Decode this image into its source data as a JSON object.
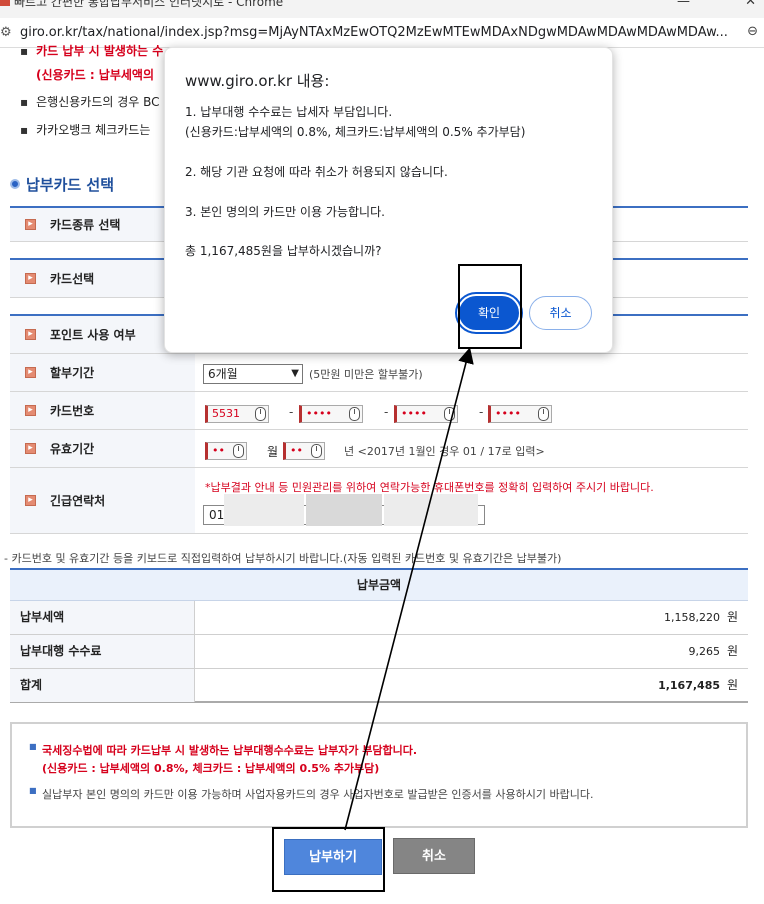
{
  "window": {
    "title": "빠르고 간편한 통합납부서비스 인터넷지로 - Chrome"
  },
  "address_bar": {
    "url": "giro.or.kr/tax/national/index.jsp?msg=MjAyNTAxMzEwOTQ2MzEwMTEwMDAxNDgwMDAwMDAwMDAwMDAw..."
  },
  "notices_top": [
    "카드 납부 시 발생하는 수",
    "(신용카드 : 납부세액의",
    "은행신용카드의 경우 BC",
    "카카오뱅크 체크카드는"
  ],
  "section": {
    "title": "납부카드 선택"
  },
  "form": {
    "card_type_label": "카드종류 선택",
    "card_select_label": "카드선택",
    "point_label": "포인트 사용 여부",
    "installment_label": "할부기간",
    "installment_value": "6개월",
    "installment_note": "(5만원 미만은 할부불가)",
    "card_number_label": "카드번호",
    "card_number_parts": [
      "5531",
      "••••",
      "••••",
      "••••"
    ],
    "expiry_label": "유효기간",
    "expiry_month": "••",
    "expiry_year": "••",
    "month_unit": "월",
    "expiry_note": "년 <2017년 1월인 경우 01 / 17로 입력>",
    "contact_label": "긴급연락처",
    "contact_notice": "*납부결과 안내 등 민원관리를 위하여 연락가능한 휴대폰번호를 정확히 입력하여 주시기 바랍니다.",
    "contact_value": "01"
  },
  "keyboard_note": "- 카드번호 및 유효기간 등을 키보드로 직접입력하여 납부하시기 바랍니다.(자동 입력된 카드번호 및 유효기간은 납부불가)",
  "amount": {
    "header": "납부금액",
    "unit": "원",
    "rows": [
      {
        "label": "납부세액",
        "value": "1,158,220"
      },
      {
        "label": "납부대행 수수료",
        "value": "9,265"
      },
      {
        "label": "합계",
        "value": "1,167,485"
      }
    ]
  },
  "notice_box": {
    "line1": "국세징수법에 따라 카드납부 시 발생하는 납부대행수수료는 납부자가 부담합니다.",
    "line2": "(신용카드 : 납부세액의 0.8%, 체크카드 : 납부세액의 0.5% 추가부담)",
    "line3": "실납부자 본인 명의의 카드만 이용 가능하며 사업자용카드의 경우 사업자번호로 발급받은 인증서를 사용하시기 바랍니다."
  },
  "buttons": {
    "pay": "납부하기",
    "cancel": "취소"
  },
  "dialog": {
    "title": "www.giro.or.kr 내용:",
    "lines": [
      "1. 납부대행 수수료는 납세자 부담입니다.",
      "(신용카드:납부세액의 0.8%, 체크카드:납부세액의 0.5% 추가부담)",
      "2. 해당 기관 요청에 따라 취소가 허용되지 않습니다.",
      "3. 본인 명의의 카드만 이용 가능합니다.",
      "총 1,167,485원을 납부하시겠습니까?"
    ],
    "ok_label": "확인",
    "cancel_label": "취소"
  },
  "colors": {
    "accent_blue": "#3c6fc2",
    "dialog_primary": "#0b57d0",
    "warning_red": "#d6001c",
    "pay_button": "#4f86dc",
    "cancel_button": "#858585"
  }
}
